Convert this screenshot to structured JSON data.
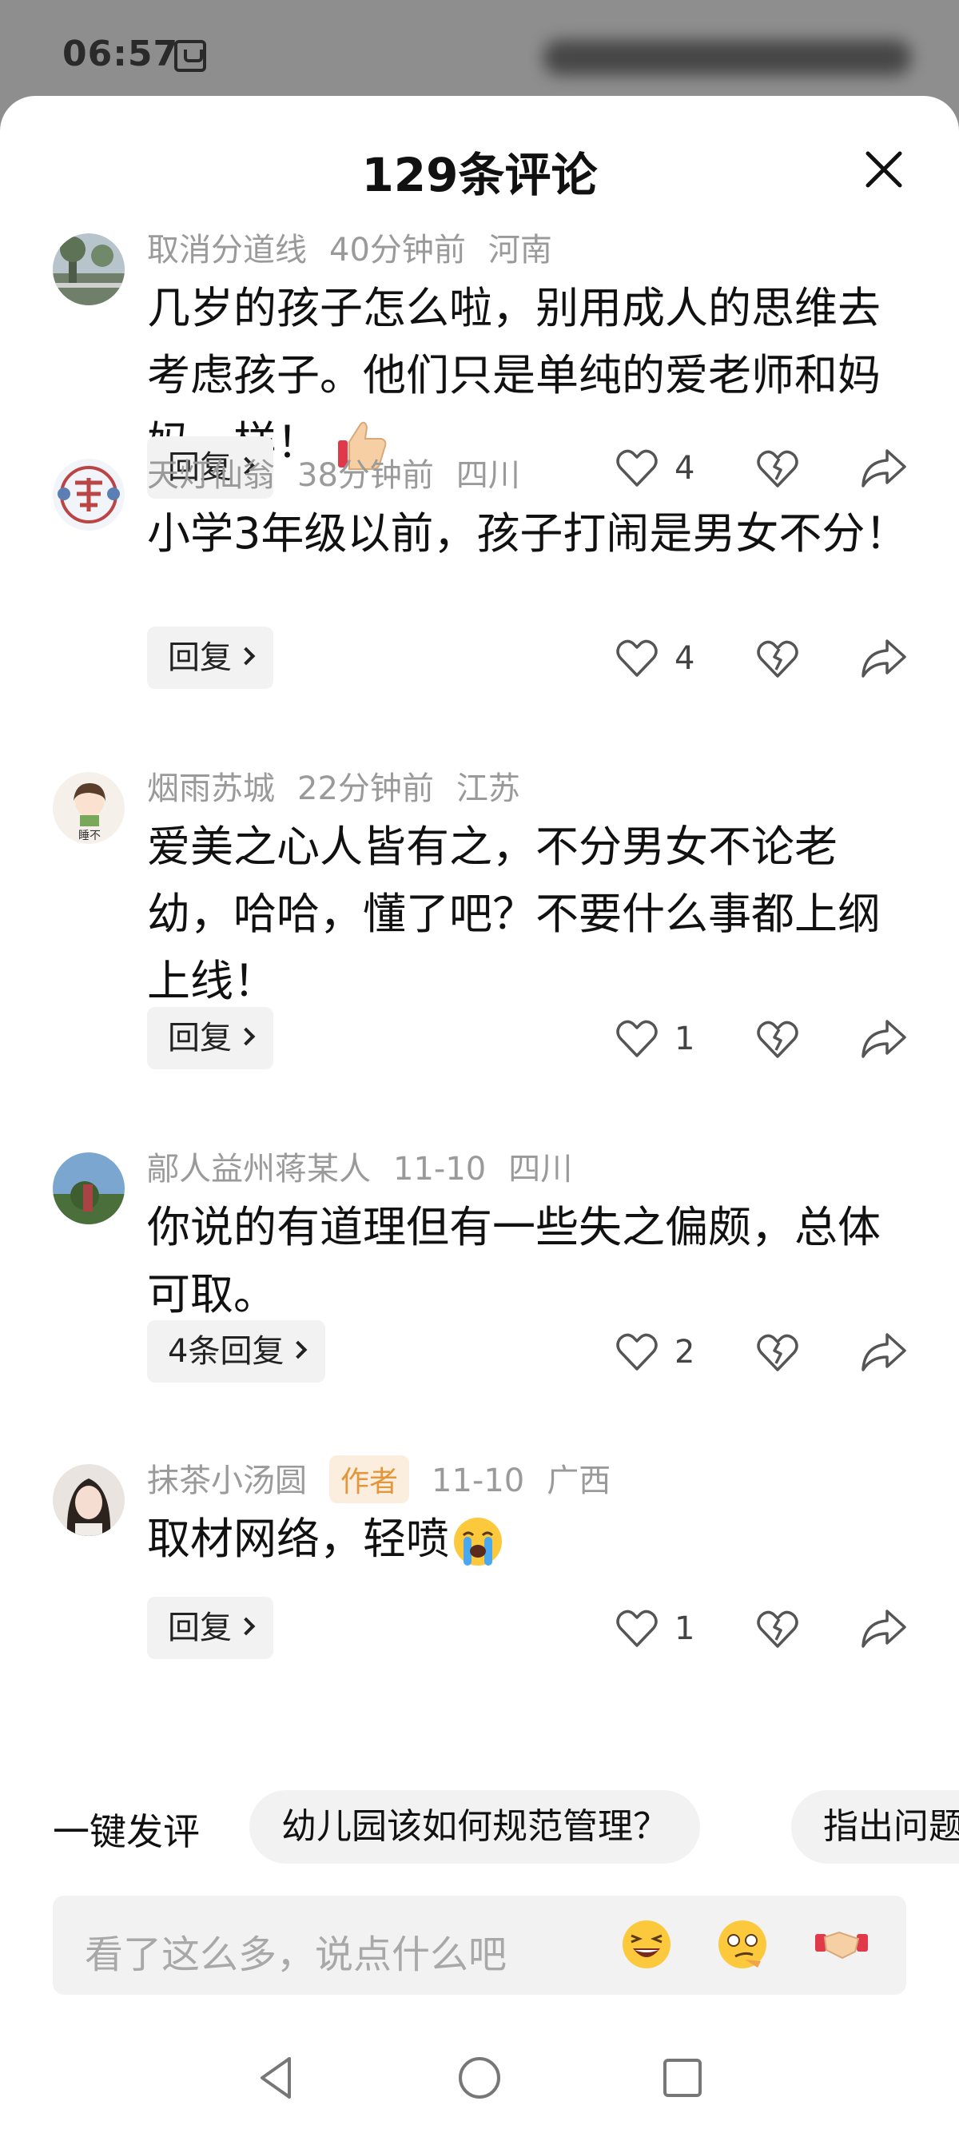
{
  "status_bar": {
    "time": "06:57"
  },
  "header": {
    "title": "129条评论"
  },
  "comments": [
    {
      "username": "取消分道线",
      "time": "40分钟前",
      "location": "河南",
      "text": "几岁的孩子怎么啦，别用成人的思维去考虑孩子。他们只是单纯的爱老师和妈妈一样！",
      "emoji": "thumbs-up",
      "reply_label": "回复",
      "likes": "4"
    },
    {
      "username": "天灯仙翁",
      "time": "38分钟前",
      "location": "四川",
      "text": "小学3年级以前，孩子打闹是男女不分！",
      "reply_label": "回复",
      "likes": "4"
    },
    {
      "username": "烟雨苏城",
      "time": "22分钟前",
      "location": "江苏",
      "text": "爱美之心人皆有之，不分男女不论老幼，哈哈，懂了吧？不要什么事都上纲上线！",
      "reply_label": "回复",
      "likes": "1"
    },
    {
      "username": "鄗人益州蒋某人",
      "time": "11-10",
      "location": "四川",
      "text": "你说的有道理但有一些失之偏颇，总体可取。",
      "reply_label": "4条回复",
      "likes": "2"
    },
    {
      "username": "抹茶小汤圆",
      "author_tag": "作者",
      "time": "11-10",
      "location": "广西",
      "text": "取材网络，轻喷",
      "emoji": "loudly-crying-face",
      "reply_label": "回复",
      "likes": "1"
    }
  ],
  "quick_comment": {
    "label": "一键发评",
    "chips": [
      "幼儿园该如何规范管理？",
      "指出问题"
    ]
  },
  "input": {
    "placeholder": "看了这么多，说点什么吧",
    "emojis": [
      "grinning-squinting-face",
      "thinking-smirk-face",
      "handshake"
    ]
  },
  "colors": {
    "meta_gray": "#9a9a9a",
    "author_tag_bg": "#fbeede",
    "author_tag_text": "#e3963a",
    "chip_bg": "#f2f2f2"
  }
}
